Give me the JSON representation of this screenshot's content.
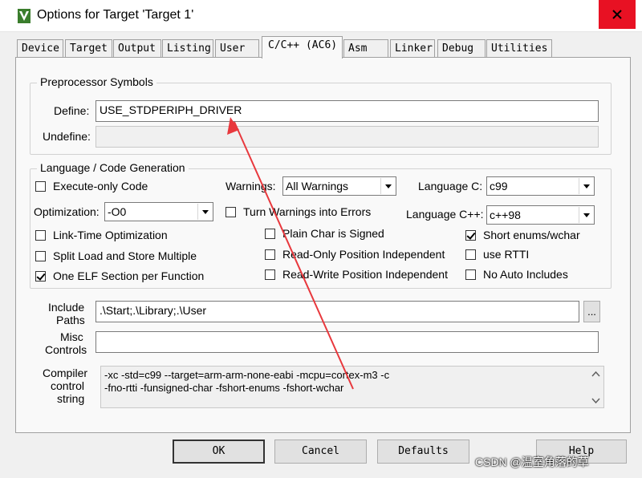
{
  "window": {
    "title": "Options for Target 'Target 1'",
    "icon": "uvision-icon",
    "close_icon": "close-icon",
    "close_color": "#e81123"
  },
  "tabs": [
    "Device",
    "Target",
    "Output",
    "Listing",
    "User",
    "C/C++ (AC6)",
    "Asm",
    "Linker",
    "Debug",
    "Utilities"
  ],
  "active_tab": "C/C++ (AC6)",
  "preprocessor": {
    "legend": "Preprocessor Symbols",
    "define_label": "Define:",
    "define_value": "USE_STDPERIPH_DRIVER",
    "undefine_label": "Undefine:",
    "undefine_value": ""
  },
  "language": {
    "legend": "Language / Code Generation",
    "execute_only": {
      "label": "Execute-only Code",
      "checked": false
    },
    "warnings_label": "Warnings:",
    "warnings_value": "All Warnings",
    "language_c_label": "Language C:",
    "language_c_value": "c99",
    "optimization_label": "Optimization:",
    "optimization_value": "-O0",
    "turn_warnings": {
      "label": "Turn Warnings into Errors",
      "checked": false
    },
    "language_cpp_label": "Language C++:",
    "language_cpp_value": "c++98",
    "link_time": {
      "label": "Link-Time Optimization",
      "checked": false
    },
    "plain_char": {
      "label": "Plain Char is Signed",
      "checked": false
    },
    "short_enums": {
      "label": "Short enums/wchar",
      "checked": true
    },
    "split_load": {
      "label": "Split Load and Store Multiple",
      "checked": false
    },
    "read_only": {
      "label": "Read-Only Position Independent",
      "checked": false
    },
    "use_rtti": {
      "label": "use RTTI",
      "checked": false
    },
    "one_elf": {
      "label": "One ELF Section per Function",
      "checked": true
    },
    "read_write": {
      "label": "Read-Write Position Independent",
      "checked": false
    },
    "no_auto": {
      "label": "No Auto Includes",
      "checked": false
    }
  },
  "include": {
    "label_line1": "Include",
    "label_line2": "Paths",
    "value": ".\\Start;.\\Library;.\\User",
    "browse_label": "..."
  },
  "misc": {
    "label_line1": "Misc",
    "label_line2": "Controls",
    "value": ""
  },
  "compiler": {
    "label_line1": "Compiler",
    "label_line2": "control",
    "label_line3": "string",
    "line1": "-xc -std=c99 --target=arm-arm-none-eabi -mcpu=cortex-m3 -c",
    "line2": "-fno-rtti -funsigned-char -fshort-enums -fshort-wchar"
  },
  "buttons": {
    "ok": "OK",
    "cancel": "Cancel",
    "defaults": "Defaults",
    "help": "Help"
  },
  "annotation": {
    "color": "#e8383d",
    "icon": "red-arrow-annotation"
  },
  "watermark": "CSDN @温室角落的草"
}
